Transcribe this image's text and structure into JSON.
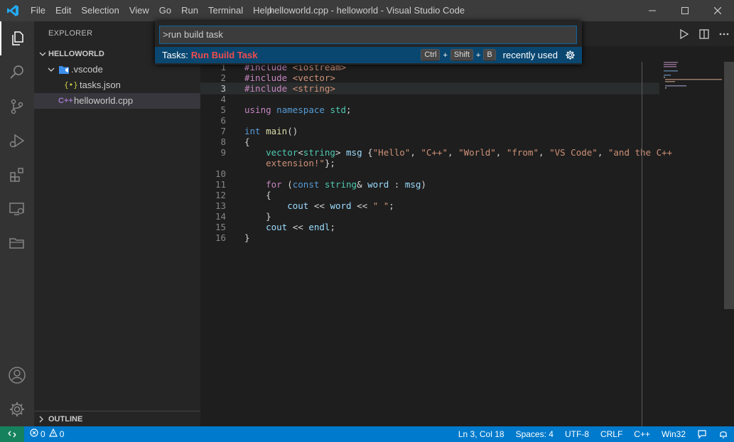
{
  "window": {
    "title": "helloworld.cpp - helloworld - Visual Studio Code",
    "menu": [
      "File",
      "Edit",
      "Selection",
      "View",
      "Go",
      "Run",
      "Terminal",
      "Help"
    ]
  },
  "sidebar": {
    "title": "EXPLORER",
    "root": "HELLOWORLD",
    "folder": ".vscode",
    "files": [
      "tasks.json",
      "helloworld.cpp"
    ],
    "outline": "OUTLINE"
  },
  "palette": {
    "input_value": ">run build task",
    "result_prefix": "Tasks:",
    "result_label": "Run Build Task",
    "keys": [
      "Ctrl",
      "+",
      "Shift",
      "+",
      "B"
    ],
    "recently_used": "recently used"
  },
  "editor": {
    "current_line": 3,
    "lines": [
      {
        "n": "1",
        "text": "#include <iostream>"
      },
      {
        "n": "2",
        "text": "#include <vector>"
      },
      {
        "n": "3",
        "text": "#include <string>"
      },
      {
        "n": "4",
        "text": ""
      },
      {
        "n": "5",
        "text": "using namespace std;"
      },
      {
        "n": "6",
        "text": ""
      },
      {
        "n": "7",
        "text": "int main()"
      },
      {
        "n": "8",
        "text": "{"
      },
      {
        "n": "9",
        "text": "    vector<string> msg {\"Hello\", \"C++\", \"World\", \"from\", \"VS Code\", \"and the C++"
      },
      {
        "n": "",
        "text": "    extension!\"};"
      },
      {
        "n": "10",
        "text": ""
      },
      {
        "n": "11",
        "text": "    for (const string& word : msg)"
      },
      {
        "n": "12",
        "text": "    {"
      },
      {
        "n": "13",
        "text": "        cout << word << \" \";"
      },
      {
        "n": "14",
        "text": "    }"
      },
      {
        "n": "15",
        "text": "    cout << endl;"
      },
      {
        "n": "16",
        "text": "}"
      }
    ]
  },
  "statusbar": {
    "errors": "0",
    "warnings": "0",
    "position": "Ln 3, Col 18",
    "spaces": "Spaces: 4",
    "encoding": "UTF-8",
    "eol": "CRLF",
    "language": "C++",
    "platform": "Win32"
  },
  "colors": {
    "accent": "#007acc",
    "highlight_match": "#f14c4c",
    "selection": "#094771"
  }
}
